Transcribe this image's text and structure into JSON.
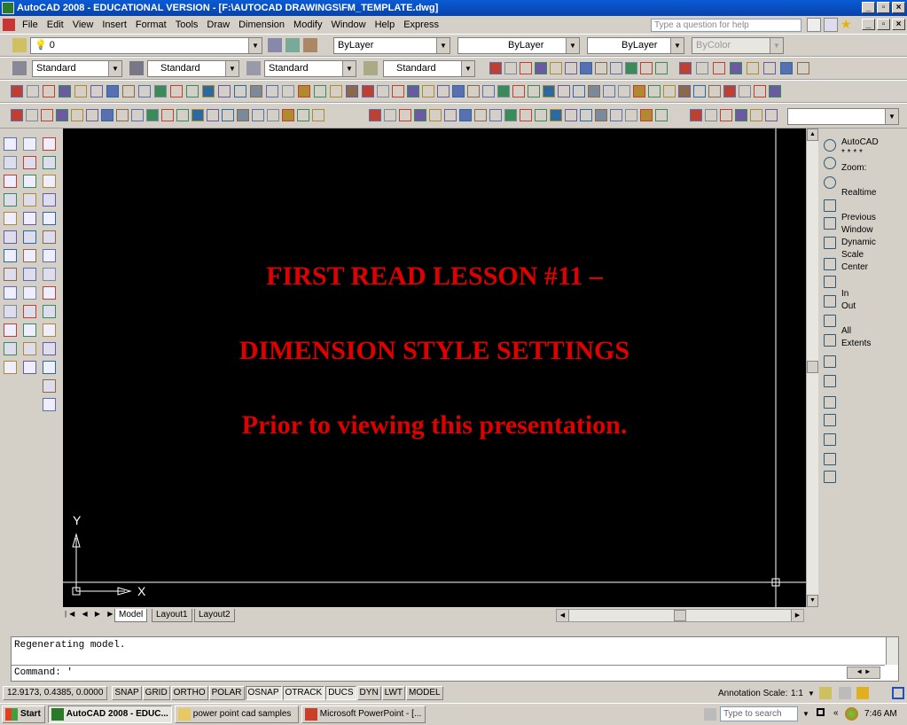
{
  "window": {
    "title": "AutoCAD 2008 - EDUCATIONAL VERSION - [F:\\AUTOCAD DRAWINGS\\FM_TEMPLATE.dwg]",
    "minimize": "_",
    "maximize": "&#9633;",
    "close": "×"
  },
  "menu": [
    "File",
    "Edit",
    "View",
    "Insert",
    "Format",
    "Tools",
    "Draw",
    "Dimension",
    "Modify",
    "Window",
    "Help",
    "Express"
  ],
  "ask": {
    "placeholder": "Type a question for help"
  },
  "layers": {
    "current": "0",
    "color": "ByLayer",
    "linetype": "ByLayer",
    "lineweight": "ByLayer",
    "plotstyle": "ByColor"
  },
  "styles": {
    "text": "Standard",
    "dim": "Standard",
    "table": "Standard",
    "mleader": "Standard"
  },
  "drawing": {
    "line1": "FIRST READ LESSON #11 –",
    "line2": "DIMENSION STYLE SETTINGS",
    "line3": "Prior to viewing this presentation.",
    "axis_x": "X",
    "axis_y": "Y"
  },
  "layout_tabs": [
    "Model",
    "Layout1",
    "Layout2"
  ],
  "command": {
    "history": "Regenerating model.",
    "prompt": "Command: '"
  },
  "zoom_panel": {
    "header": "AutoCAD",
    "stars": "* * * *",
    "zoom": "Zoom:",
    "items": [
      "Realtime",
      "Previous",
      "Window",
      "Dynamic",
      "Scale",
      "Center",
      "In",
      "Out",
      "All",
      "Extents"
    ]
  },
  "status": {
    "coords": "12.9173, 0.4385, 0.0000",
    "toggles": [
      {
        "label": "SNAP",
        "on": false
      },
      {
        "label": "GRID",
        "on": false
      },
      {
        "label": "ORTHO",
        "on": false
      },
      {
        "label": "POLAR",
        "on": false
      },
      {
        "label": "OSNAP",
        "on": true
      },
      {
        "label": "OTRACK",
        "on": true
      },
      {
        "label": "DUCS",
        "on": true
      },
      {
        "label": "DYN",
        "on": false
      },
      {
        "label": "LWT",
        "on": false
      },
      {
        "label": "MODEL",
        "on": false
      }
    ],
    "annotation_scale_label": "Annotation Scale:",
    "annotation_scale": "1:1"
  },
  "taskbar": {
    "start": "Start",
    "tasks": [
      "AutoCAD 2008 - EDUC...",
      "power point cad samples",
      "Microsoft PowerPoint - [..."
    ],
    "search_placeholder": "Type to search",
    "time": "7:46 AM"
  },
  "colors": {
    "canvas": "#000000",
    "text_red": "#e00000",
    "titlebar": "#0a5bd6"
  }
}
